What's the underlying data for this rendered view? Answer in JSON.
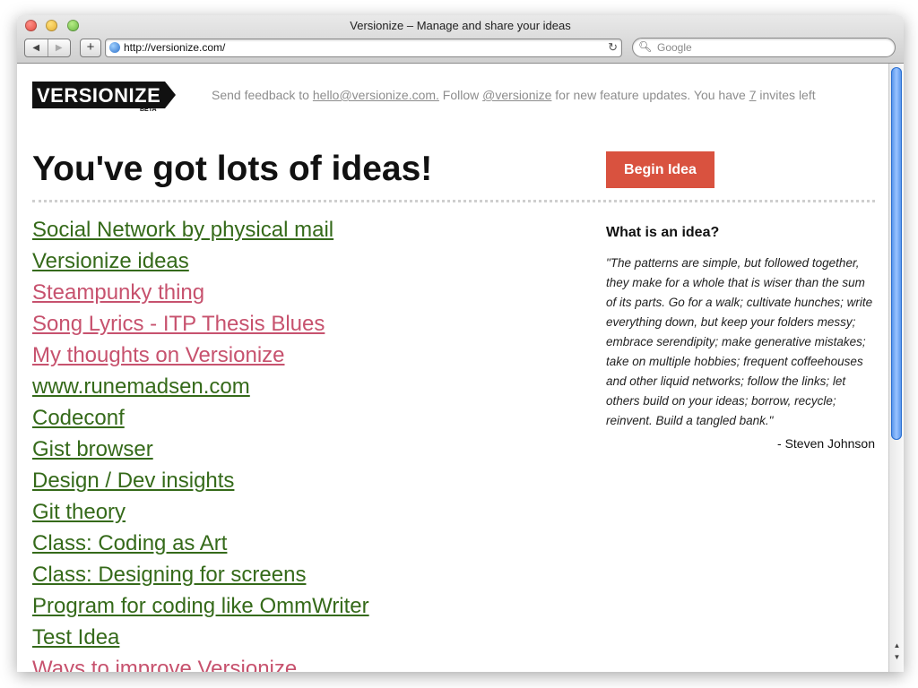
{
  "window": {
    "title": "Versionize – Manage and share your ideas"
  },
  "toolbar": {
    "back_glyph": "◀",
    "forward_glyph": "▶",
    "add_glyph": "+",
    "url": "http://versionize.com/",
    "reload_glyph": "↻",
    "search_placeholder": "Google"
  },
  "header": {
    "logo_text": "VERSIONIZE",
    "logo_badge": "BETA",
    "feedback_prefix": "Send feedback to ",
    "feedback_email": "hello@versionize.com.",
    "follow_text": " Follow ",
    "twitter_handle": "@versionize",
    "updates_text": " for new feature updates. You have ",
    "invites_count": "7",
    "invites_suffix": " invites left"
  },
  "main": {
    "headline": "You've got lots of ideas!",
    "begin_button": "Begin Idea",
    "ideas": [
      {
        "label": "Social Network by physical mail",
        "color": "#356a1a"
      },
      {
        "label": "Versionize ideas",
        "color": "#356a1a"
      },
      {
        "label": "Steampunky thing",
        "color": "#c7526e"
      },
      {
        "label": "Song Lyrics - ITP Thesis Blues",
        "color": "#c7526e"
      },
      {
        "label": "My thoughts on Versionize",
        "color": "#c7526e"
      },
      {
        "label": "www.runemadsen.com",
        "color": "#356a1a"
      },
      {
        "label": "Codeconf",
        "color": "#356a1a"
      },
      {
        "label": "Gist browser",
        "color": "#356a1a"
      },
      {
        "label": "Design / Dev insights",
        "color": "#356a1a"
      },
      {
        "label": "Git theory",
        "color": "#356a1a"
      },
      {
        "label": "Class: Coding as Art",
        "color": "#356a1a"
      },
      {
        "label": "Class: Designing for screens",
        "color": "#356a1a"
      },
      {
        "label": "Program for coding like OmmWriter",
        "color": "#356a1a"
      },
      {
        "label": "Test Idea",
        "color": "#356a1a"
      },
      {
        "label": "Ways to improve Versionize",
        "color": "#c7526e"
      }
    ]
  },
  "sidebar": {
    "heading": "What is an idea?",
    "quote": "\"The patterns are simple, but followed together, they make for a whole that is wiser than the sum of its parts. Go for a walk; cultivate hunches; write everything down, but keep your folders messy; embrace serendipity; make generative mistakes; take on multiple hobbies; frequent coffeehouses and other liquid networks; follow the links; let others build on your ideas; borrow, recycle; reinvent. Build a tangled bank.\"",
    "author": "- Steven Johnson"
  },
  "colors": {
    "accent_button": "#d9523f",
    "link_green": "#356a1a",
    "link_pink": "#c7526e"
  }
}
